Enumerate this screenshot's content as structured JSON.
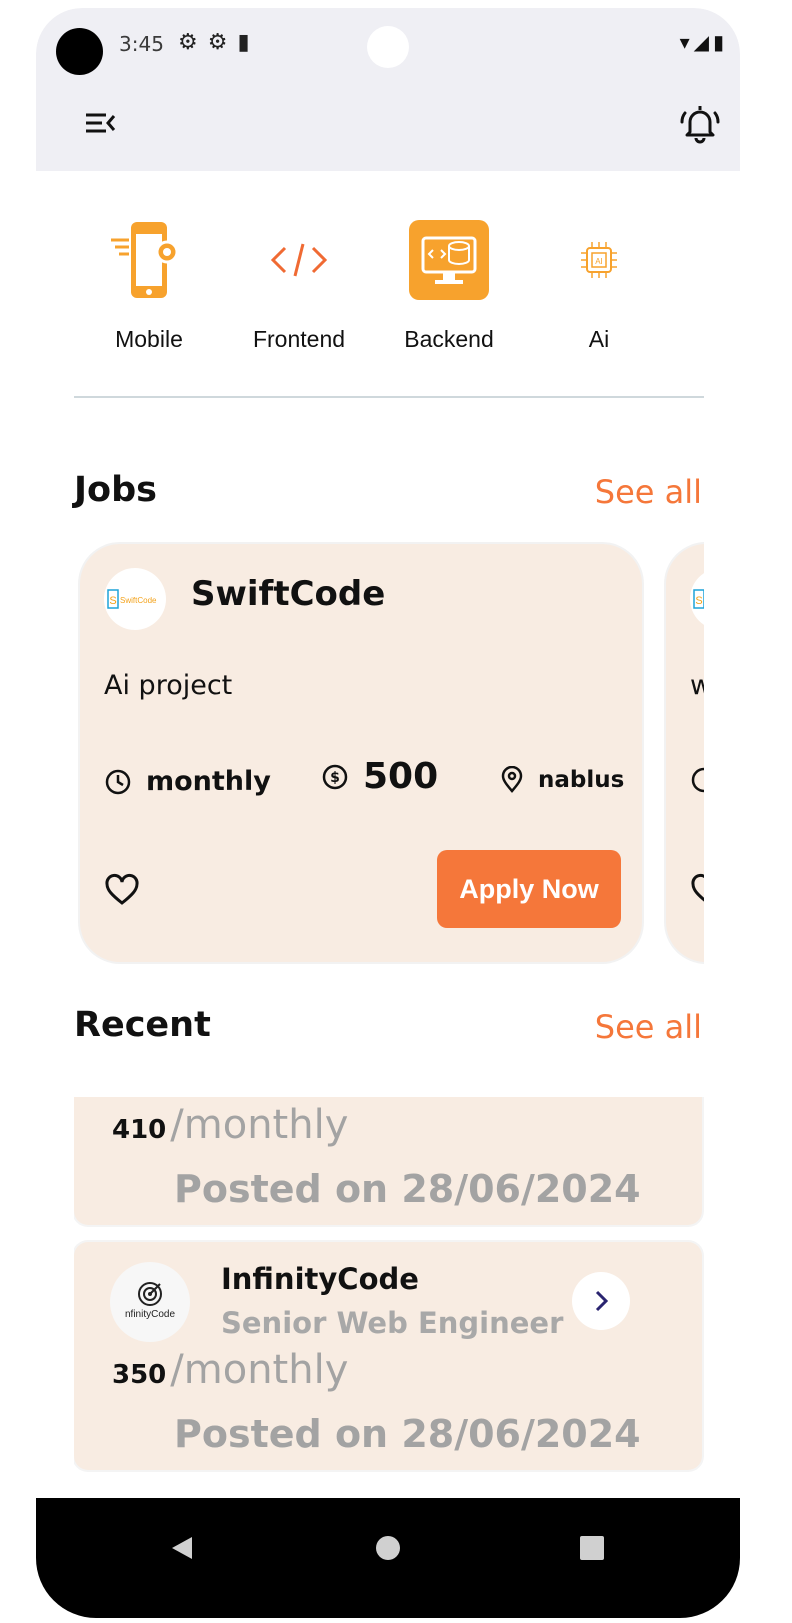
{
  "status_bar": {
    "time": "3:45",
    "left_icons": [
      "gear-icon",
      "gear-icon",
      "sd-card-icon"
    ],
    "right_icons": [
      "wifi-icon",
      "signal-icon",
      "battery-icon"
    ]
  },
  "header": {
    "menu_icon": "menu-collapse-icon",
    "bell_icon": "notification-bell-icon"
  },
  "categories": [
    {
      "label": "Mobile",
      "icon": "mobile-settings-icon",
      "active": false
    },
    {
      "label": "Frontend",
      "icon": "code-brackets-icon",
      "active": false
    },
    {
      "label": "Backend",
      "icon": "database-monitor-icon",
      "active": true
    },
    {
      "label": "Ai",
      "icon": "ai-chip-icon",
      "active": false
    }
  ],
  "jobs": {
    "title": "Jobs",
    "see_all": "See all",
    "cards": [
      {
        "company": "SwiftCode",
        "logo_text": "SwiftCode",
        "project": "Ai project",
        "period": "monthly",
        "salary": "500",
        "location": "nablus",
        "apply_label": "Apply Now"
      },
      {
        "company": "",
        "logo_text": "",
        "project": "w",
        "period": "",
        "salary": "",
        "location": "",
        "apply_label": ""
      }
    ]
  },
  "recent": {
    "title": "Recent",
    "see_all": "See all",
    "items": [
      {
        "company": "",
        "role": "",
        "salary": "410",
        "period": "/monthly",
        "posted": "Posted on 28/06/2024",
        "logo_text": ""
      },
      {
        "company": "InfinityCode",
        "role": "Senior Web Engineer",
        "salary": "350",
        "period": "/monthly",
        "posted": "Posted on 28/06/2024",
        "logo_text": "nfinityCode"
      }
    ]
  },
  "colors": {
    "accent": "#f5773a",
    "category_active": "#f7a22d",
    "card_bg": "#f8ece2",
    "header_bg": "#efeff4"
  }
}
